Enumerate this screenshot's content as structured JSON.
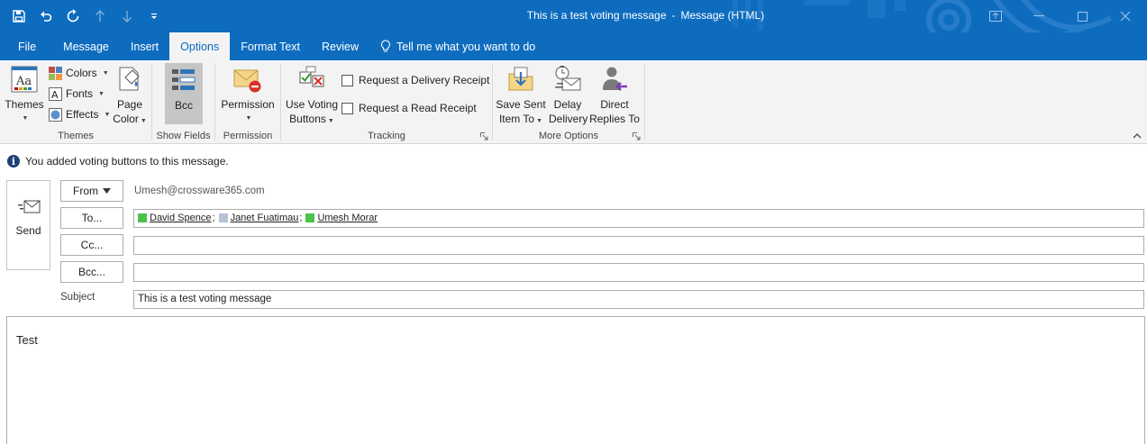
{
  "window": {
    "title": "This is a test voting message",
    "title_sep": "-",
    "app_name": "Message (HTML)"
  },
  "quick_access": [
    "save-icon",
    "undo-icon",
    "redo-icon",
    "up-arrow-icon",
    "down-arrow-icon",
    "customize-icon"
  ],
  "tabs": {
    "file": "File",
    "message": "Message",
    "insert": "Insert",
    "options": "Options",
    "format_text": "Format Text",
    "review": "Review",
    "tell_me": "Tell me what you want to do"
  },
  "ribbon": {
    "themes_group": {
      "themes": "Themes",
      "colors": "Colors",
      "fonts": "Fonts",
      "effects": "Effects",
      "page": "Page",
      "color": "Color",
      "label": "Themes"
    },
    "show_fields_group": {
      "bcc": "Bcc",
      "label": "Show Fields"
    },
    "permission_group": {
      "permission": "Permission",
      "label": "Permission"
    },
    "tracking_group": {
      "use_voting": "Use Voting",
      "buttons": "Buttons",
      "delivery_receipt": "Request a Delivery Receipt",
      "read_receipt": "Request a Read Receipt",
      "label": "Tracking"
    },
    "more_options_group": {
      "save_sent_1": "Save Sent",
      "save_sent_2": "Item To",
      "delay_1": "Delay",
      "delay_2": "Delivery",
      "direct_1": "Direct",
      "direct_2": "Replies To",
      "label": "More Options"
    }
  },
  "infobar": {
    "text": "You added voting buttons to this message."
  },
  "compose": {
    "send": "Send",
    "from_label": "From",
    "from_value": "Umesh@crossware365.com",
    "to_label": "To...",
    "cc_label": "Cc...",
    "bcc_label": "Bcc...",
    "subject_label": "Subject",
    "subject_value": "This is a test voting message",
    "recipients": [
      {
        "name": "David Spence",
        "color": "#4cc24c"
      },
      {
        "name": "Janet Fuatimau",
        "color": "#b4c4d6"
      },
      {
        "name": "Umesh Morar",
        "color": "#4cc24c"
      }
    ],
    "body": "Test"
  },
  "colors": {
    "accent": "#0e6cbf",
    "ribbon_bg": "#f3f3f3"
  }
}
